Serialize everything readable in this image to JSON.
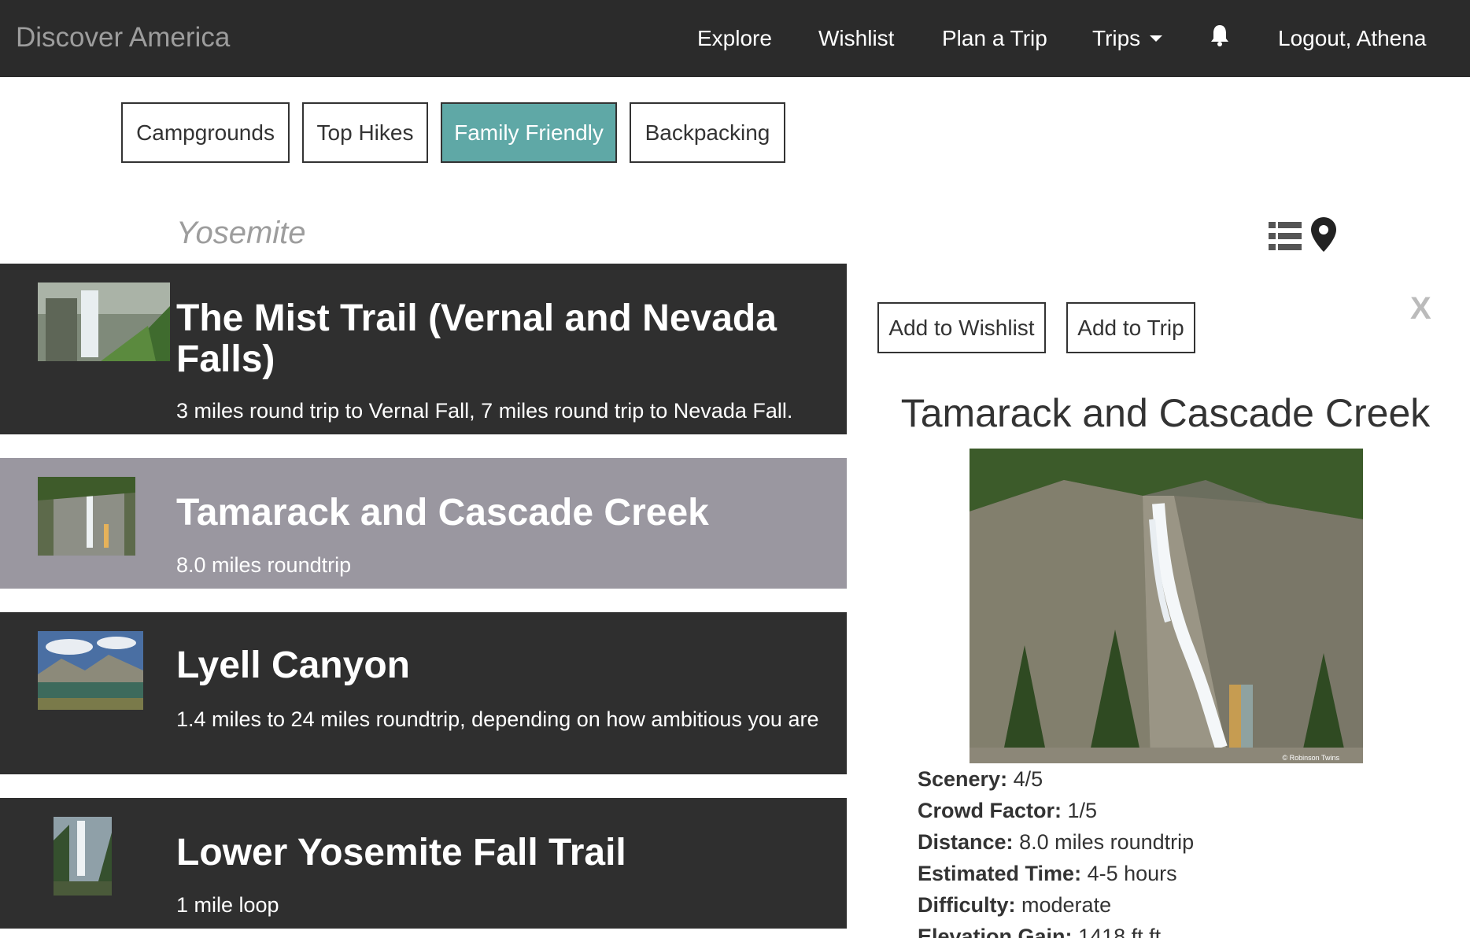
{
  "navbar": {
    "brand": "Discover America",
    "items": [
      "Explore",
      "Wishlist",
      "Plan a Trip",
      "Trips"
    ],
    "logout": "Logout, Athena"
  },
  "filters": [
    "Campgrounds",
    "Top Hikes",
    "Family Friendly",
    "Backpacking"
  ],
  "active_filter": "Family Friendly",
  "park": "Yosemite",
  "trails": [
    {
      "name": "The Mist Trail (Vernal and Nevada Falls)",
      "desc": "3 miles round trip to Vernal Fall, 7 miles round trip to Nevada Fall."
    },
    {
      "name": "Tamarack and Cascade Creek",
      "desc": "8.0 miles roundtrip"
    },
    {
      "name": "Lyell Canyon",
      "desc": "1.4 miles to 24 miles roundtrip, depending on how ambitious you are"
    },
    {
      "name": "Lower Yosemite Fall Trail",
      "desc": "1 mile loop"
    }
  ],
  "detail": {
    "wishlist_btn": "Add to Wishlist",
    "trip_btn": "Add to Trip",
    "close": "X",
    "title": "Tamarack and Cascade Creek",
    "image_credit": "© Robinson Twins",
    "stats": [
      {
        "label": "Scenery:",
        "value": "4/5"
      },
      {
        "label": "Crowd Factor:",
        "value": "1/5"
      },
      {
        "label": "Distance:",
        "value": "8.0 miles roundtrip"
      },
      {
        "label": "Estimated Time:",
        "value": "4-5 hours"
      },
      {
        "label": "Difficulty:",
        "value": "moderate"
      },
      {
        "label": "Elevation Gain:",
        "value": "1418 ft ft"
      }
    ]
  },
  "colors": {
    "navbar": "#2b2b2b",
    "active_filter": "#5fa8a6",
    "trail_bg": "#2f2f2f",
    "selected_trail_bg": "#9a97a0"
  },
  "icons": [
    "bell-icon",
    "list-view-icon",
    "map-pin-icon",
    "caret-down-icon"
  ]
}
